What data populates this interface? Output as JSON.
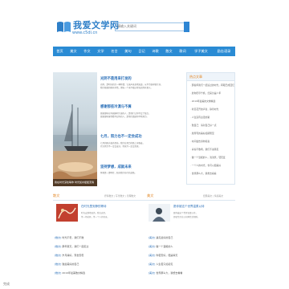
{
  "header": {
    "logo_title": "我爱文学网",
    "logo_domain": "www.c5di.cn"
  },
  "search": {
    "placeholder": "请输入关键词"
  },
  "nav": {
    "items": [
      "首页",
      "美文",
      "作文",
      "文学",
      "名言",
      "美句",
      "日记",
      "诗歌",
      "散文",
      "歌词",
      "学子美文",
      "励志语录"
    ]
  },
  "hero": {
    "caption": "我在时光深处等你 时光如水缓缓流淌"
  },
  "articles": [
    {
      "title": "光阴不是用来打发的",
      "lines": [
        "光阴，是时间的另一种称谓，它无声无息地流逝，从不为谁停留片刻，",
        "我们能做的唯有珍惜，把每一个当下都过得充实而有意义。"
      ]
    },
    {
      "title": "感谢那些冷漠与不屑",
      "lines": [
        "感谢那些在你困难时冷漠的人，是他们让你学会了独立，",
        "感谢那些曾经看不起你的人，是他们激励你不断努力。"
      ]
    },
    {
      "title": "七月，努力也不一定会成功",
      "lines": [
        "七月的阳光格外炽热，我们在努力的路上奔跑着，",
        "也许努力不一定会成功，但放弃一定会失败。"
      ]
    },
    {
      "title": "坚持梦想，成就未来",
      "lines": [
        "梦想是一盏明灯，照亮我们前行的道路。"
      ]
    }
  ],
  "sidebar": {
    "title": "热点文章",
    "items": [
      "· 那些年我们一起追过的时光，转眼已成回忆",
      "· 愿你历尽千帆，归来仍是少年",
      "· 2019年最美的文章精选",
      "· 听见花开的声音，静待时光",
      "· 人生没有白走的路",
      "· 致自己：请对自己好一点",
      "· 愿所有的美好如期而至",
      "· 时间会告诉你答案",
      "· 青春不散场，我们不说再见",
      "· 做一个温暖的人，浅浅笑，轻轻爱",
      "· 一个人的时光，也可以很美好",
      "· 世界那么大，我想去看看"
    ]
  },
  "section_left": {
    "title": "散文",
    "tabs": "抒情散文 | 写景散文 | 哲理散文",
    "feature_title": "在时光里安静的等待",
    "feature_lines": [
      "时光安静地流淌，我在这里，",
      "等一场花开，等一个人的归来。"
    ],
    "rows": [
      {
        "tag": "[散文]",
        "text": "时光不老，我们不散"
      },
      {
        "tag": "[散文]",
        "text": "那年夏天，我们一起走过"
      },
      {
        "tag": "[散文]",
        "text": "岁月静好，现世安稳"
      },
      {
        "tag": "[散文]",
        "text": "致最美好的自己"
      },
      {
        "tag": "[散文]",
        "text": "2019年最美散文精选"
      }
    ]
  },
  "section_right": {
    "title": "美文",
    "tabs": "经典美文 | 情感美文",
    "feature_title": "愿你被这个世界温柔以待",
    "feature_lines": [
      "愿你被这个世界温柔以待，",
      "即使生命总以刻薄荒芜相欺。"
    ],
    "rows": [
      {
        "tag": "[美文]",
        "text": "遇见最好的自己"
      },
      {
        "tag": "[美文]",
        "text": "做一个温暖的人"
      },
      {
        "tag": "[美文]",
        "text": "你若安好，便是晴天"
      },
      {
        "tag": "[美文]",
        "text": "人生若只如初见"
      },
      {
        "tag": "[美文]",
        "text": "世界那么大，我想去看看"
      }
    ]
  },
  "status": {
    "text": "完成"
  },
  "colors": {
    "brand_blue": "#2a8bd4",
    "link_blue": "#2a6fb8",
    "heading_orange": "#e3892a"
  }
}
